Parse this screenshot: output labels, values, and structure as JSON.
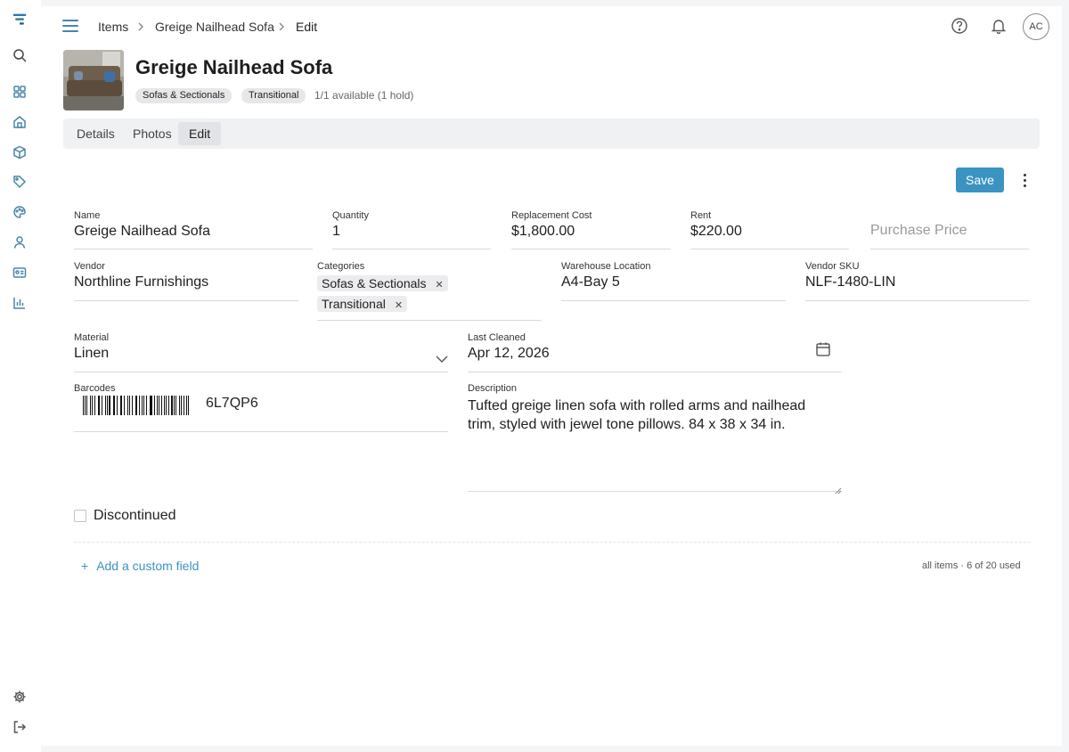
{
  "sidebar": {
    "icons": [
      "logo-icon",
      "search-icon",
      "dashboard-icon",
      "home-icon",
      "box-icon",
      "tag-icon",
      "palette-icon",
      "user-icon",
      "id-card-icon",
      "reports-icon",
      "settings-icon",
      "logout-icon"
    ]
  },
  "breadcrumb": [
    "Items",
    "Greige Nailhead Sofa",
    "Edit"
  ],
  "user": {
    "initials": "AC"
  },
  "item": {
    "title": "Greige Nailhead Sofa",
    "chips": [
      "Sofas & Sectionals",
      "Transitional"
    ],
    "availability": "1/1 available (1 hold)"
  },
  "tabs": [
    {
      "label": "Details",
      "active": false
    },
    {
      "label": "Photos",
      "active": false
    },
    {
      "label": "Edit",
      "active": true
    }
  ],
  "actions": {
    "save_label": "Save"
  },
  "form": {
    "name": {
      "label": "Name",
      "value": "Greige Nailhead Sofa"
    },
    "quantity": {
      "label": "Quantity",
      "value": "1"
    },
    "replacement_cost": {
      "label": "Replacement Cost",
      "value": "$1,800.00"
    },
    "rent": {
      "label": "Rent",
      "value": "$220.00"
    },
    "purchase_price": {
      "placeholder": "Purchase Price"
    },
    "vendor": {
      "label": "Vendor",
      "value": "Northline Furnishings"
    },
    "categories": {
      "label": "Categories",
      "values": [
        "Sofas & Sectionals",
        "Transitional"
      ]
    },
    "warehouse_location": {
      "label": "Warehouse Location",
      "value": "A4-Bay 5"
    },
    "vendor_sku": {
      "label": "Vendor SKU",
      "value": "NLF-1480-LIN"
    },
    "material": {
      "label": "Material",
      "value": "Linen"
    },
    "last_cleaned": {
      "label": "Last Cleaned",
      "value": "Apr 12, 2026"
    },
    "barcodes": {
      "label": "Barcodes",
      "value": "6L7QP6"
    },
    "description": {
      "label": "Description",
      "value": "Tufted greige linen sofa with rolled arms and nailhead trim, styled with jewel tone pillows. 84 x 38 x 34 in."
    },
    "discontinued": {
      "label": "Discontinued",
      "checked": false
    }
  },
  "footer": {
    "add_custom_field": "Add a custom field",
    "usage": "all items · 6 of 20 used"
  },
  "colors": {
    "accent": "#3b93c2",
    "rail_icon": "#4a86a8"
  }
}
